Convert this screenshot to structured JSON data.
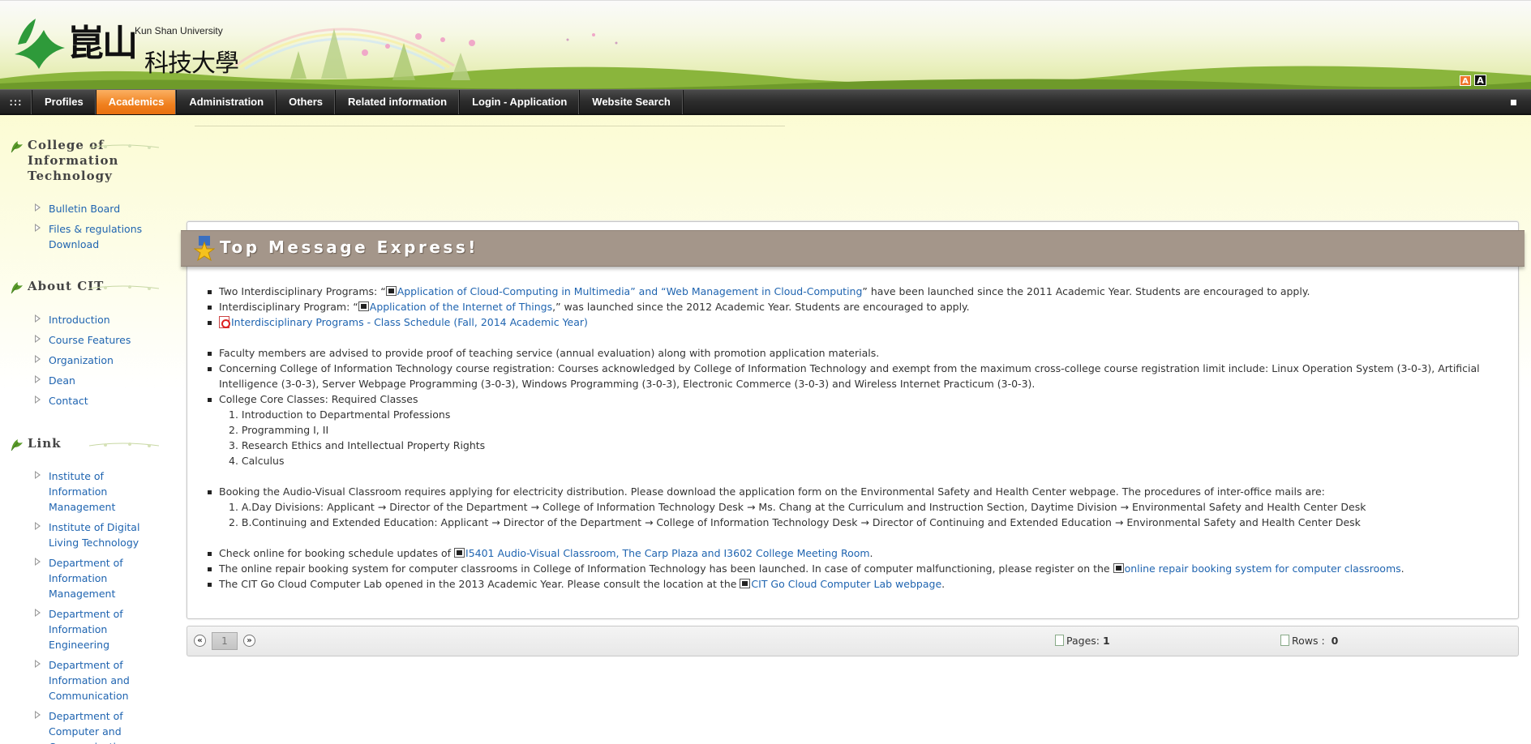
{
  "header": {
    "univ_en": "Kun Shan University",
    "univ_cn_1": "崑山",
    "univ_cn_2": "科技大學",
    "font_a": "A",
    "font_b": "A"
  },
  "nav": {
    "grid": ":::",
    "items": [
      "Profiles",
      "Academics",
      "Administration",
      "Others",
      "Related information",
      "Login - Application",
      "Website Search"
    ],
    "active_index": 1,
    "active_color": "#f0801e"
  },
  "sidebar": {
    "sections": [
      {
        "title": "College of Information Technology",
        "items": [
          "Bulletin Board",
          "Files & regulations Download"
        ]
      },
      {
        "title": "About CIT",
        "items": [
          "Introduction",
          "Course Features",
          "Organization",
          "Dean",
          "Contact"
        ]
      },
      {
        "title": "Link",
        "items": [
          "Institute of Information Management",
          "Institute of Digital Living Technology",
          "Department of Information Management",
          "Department of Information Engineering",
          "Department of Information and Communication",
          "Department of Computer and Communication"
        ]
      }
    ]
  },
  "banner": {
    "title": "Top Message Express!",
    "color": "#a4968a"
  },
  "content": {
    "l1_pre": "Two Interdisciplinary Programs: “",
    "l1_link": "Application of Cloud-Computing in Multimedia” and “Web Management in Cloud-Computing",
    "l1_post": "” have been launched since the 2011 Academic Year. Students are encouraged to apply.",
    "l2_pre": "Interdisciplinary Program: “",
    "l2_link": "Application of the Internet of Things",
    "l2_post": ",” was launched since the 2012 Academic Year. Students are encouraged to apply.",
    "l3_link": "Interdisciplinary Programs - Class Schedule (Fall, 2014 Academic Year)",
    "l4": "Faculty members are advised to provide proof of teaching service (annual evaluation) along with promotion application materials.",
    "l5": "Concerning College of Information Technology course registration: Courses acknowledged by College of Information Technology and exempt from the maximum cross-college course registration limit include: Linux Operation System (3-0-3), Artificial Intelligence (3-0-3), Server Webpage Programming (3-0-3), Windows Programming (3-0-3), Electronic Commerce (3-0-3) and Wireless Internet Practicum (3-0-3).",
    "l6": "College Core Classes: Required Classes",
    "core": [
      "1. Introduction to Departmental Professions",
      "2. Programming I, II",
      "3. Research Ethics and Intellectual Property Rights",
      "4. Calculus"
    ],
    "l7": "Booking the Audio-Visual Classroom requires applying for electricity distribution. Please download the application form on the Environmental Safety and Health Center webpage. The procedures of inter-office mails are:",
    "mail": [
      "A.Day Divisions: Applicant → Director of the Department → College of Information Technology Desk → Ms. Chang at the Curriculum and Instruction Section, Daytime Division → Environmental Safety and Health Center Desk",
      "B.Continuing and Extended Education: Applicant → Director of the Department → College of Information Technology Desk → Director of Continuing and Extended Education → Environmental Safety and Health Center Desk"
    ],
    "l8_pre": "Check online for booking schedule updates of ",
    "l8_link": "I5401 Audio-Visual Classroom, The Carp Plaza and I3602 College Meeting Room",
    "l8_post": ".",
    "l9_pre": "The online repair booking system for computer classrooms in College of Information Technology has been launched. In case of computer malfunctioning, please register on the ",
    "l9_link": "online repair booking system for computer classrooms",
    "l9_post": ".",
    "l10_pre": "The CIT Go Cloud Computer Lab opened in the 2013 Academic Year. Please consult the location at the ",
    "l10_link": "CIT Go Cloud Computer Lab webpage",
    "l10_post": "."
  },
  "pager": {
    "prev": "«",
    "next": "»",
    "current": "1",
    "pages_label": "Pages:",
    "pages_value": "1",
    "rows_label": "Rows :",
    "rows_value": "0"
  }
}
